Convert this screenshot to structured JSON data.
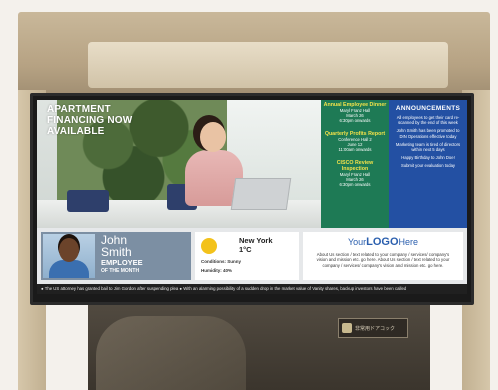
{
  "hero": {
    "title": "Apartment Financing Now Available"
  },
  "schedule": [
    {
      "title": "Annual Employee Dinner",
      "location": "Maryl Franz Hall",
      "date": "March 26",
      "time": "6:30pm onwards"
    },
    {
      "title": "Quarterly Profits Report",
      "location": "Conference Hall 2",
      "date": "June 12",
      "time": "11:00am onwards"
    },
    {
      "title": "CISCO Review Inspection",
      "location": "Maryl Franz Hall",
      "date": "March 26",
      "time": "6:30pm onwards"
    }
  ],
  "announcements": {
    "title": "ANNOUNCEMENTS",
    "items": [
      "All employees to get their card re-scanned by the end of this week",
      "John Smith has been promoted to DIN Operations effective today",
      "Marketing team is tired of directors within next 5 days",
      "Happy Birthday to John Doe!",
      "Submit your evaluation today"
    ]
  },
  "employee": {
    "first_name": "John",
    "last_name": "Smith",
    "role": "EMPLOYEE",
    "subtitle": "OF THE MONTH"
  },
  "weather": {
    "city": "New York",
    "temperature": "1°C",
    "conditions": "Conditions: Sunny",
    "humidity": "Humidity: 40%",
    "icon": "sun-icon"
  },
  "logo": {
    "prefix": "Your",
    "word": "LOGO",
    "suffix": "Here",
    "description": "About Us section / text related to your company / services/ company's vision and mission etc. go here. About Us section / text related to your company / services/ company's vision and mission etc. go here."
  },
  "ticker": {
    "text": "● The US attorney has granted bail to Jim Gordon after suspending plea   ● With an alarming possibility of a sudden drop in the market value of Vanity shares, backup investors have been called"
  },
  "door_sticker": {
    "text": "非常用ドアコック"
  },
  "colors": {
    "schedule_bg": "#1e7a55",
    "announce_bg": "#2350a3",
    "employee_bg": "#7c8fa3",
    "sun": "#f3c21b"
  }
}
